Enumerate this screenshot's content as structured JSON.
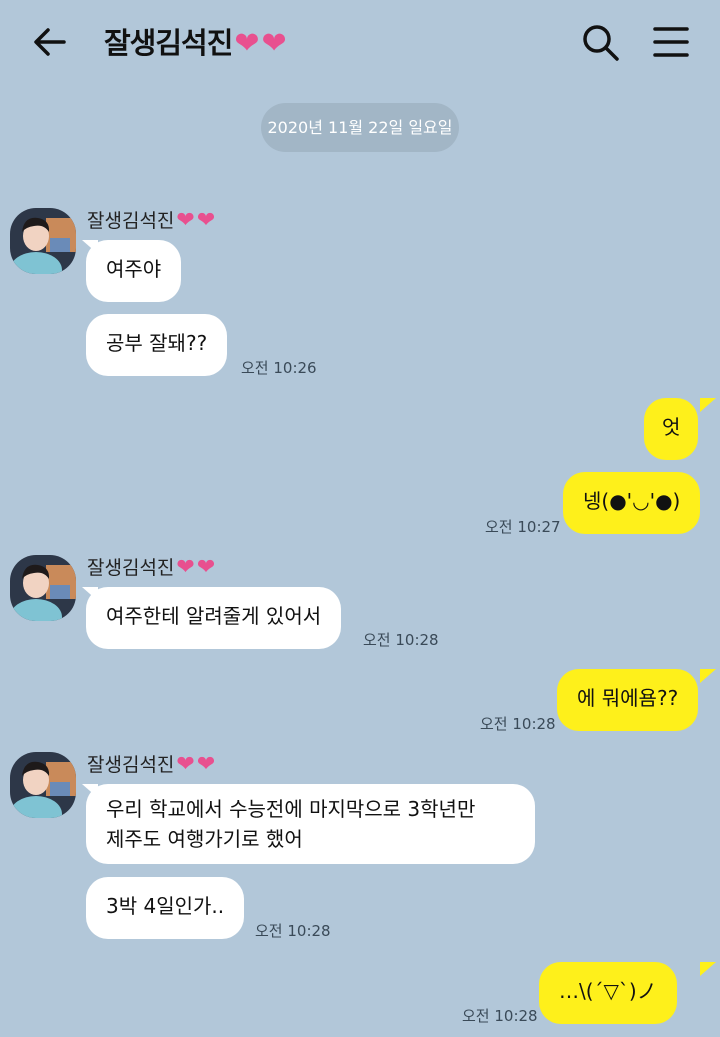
{
  "header": {
    "title": "잘생김석진",
    "title_hearts": "❤❤"
  },
  "date_divider": "2020년 11월 22일 일요일",
  "sender_name": "잘생김석진",
  "sender_hearts": "❤❤",
  "messages": [
    {
      "text": "여주야"
    },
    {
      "text": "공부 잘돼??",
      "time": "오전 10:26"
    },
    {
      "text": "엇"
    },
    {
      "text": "넹(●'◡'●)",
      "time": "오전 10:27"
    },
    {
      "text": "여주한테 알려줄게 있어서",
      "time": "오전 10:28"
    },
    {
      "text": "에 뭐에욤??",
      "time": "오전 10:28"
    },
    {
      "text_line1": "우리 학교에서 수능전에 마지막으로 3학년만",
      "text_line2": "제주도 여행가기로 했어"
    },
    {
      "text": "3박 4일인가..",
      "time": "오전 10:28"
    },
    {
      "text": "…\\(´▽`)ノ",
      "time": "오전 10:28"
    }
  ],
  "colors": {
    "background": "#b2c7d9",
    "my_bubble": "#fef01b",
    "other_bubble": "#ffffff",
    "heart": "#e8508f"
  }
}
